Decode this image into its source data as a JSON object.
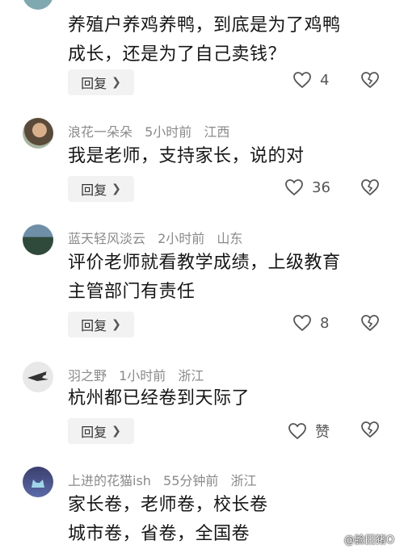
{
  "comments": [
    {
      "body": [
        "养殖户养鸡养鸭，到底是为了鸡鸭",
        "成长，还是为了自己卖钱？"
      ],
      "reply_label": "回复",
      "likes": "4"
    },
    {
      "username": "浪花一朵朵",
      "time": "5小时前",
      "location": "江西",
      "body": [
        "我是老师，支持家长，说的对"
      ],
      "reply_label": "回复",
      "likes": "36"
    },
    {
      "username": "蓝天轻风淡云",
      "time": "2小时前",
      "location": "山东",
      "body": [
        "评价老师就看教学成绩，上级教育",
        "主管部门有责任"
      ],
      "reply_label": "回复",
      "likes": "8"
    },
    {
      "username": "羽之野",
      "time": "1小时前",
      "location": "浙江",
      "body": [
        "杭州都已经卷到天际了"
      ],
      "reply_label": "回复",
      "likes": "赞"
    },
    {
      "username": "上进的花猫ish",
      "time": "55分钟前",
      "location": "浙江",
      "body": [
        "家长卷，老师卷，校长卷",
        "城市卷，省卷，全国卷"
      ]
    }
  ],
  "watermark": "@脸田猪O",
  "colors": {
    "meta": "#8a8a8a",
    "text": "#161616",
    "reply_bg": "#f2f2f2"
  },
  "icons": {
    "like": "heart-outline-icon",
    "dislike": "broken-heart-icon",
    "reply_chevron": "chevron-right-icon"
  }
}
